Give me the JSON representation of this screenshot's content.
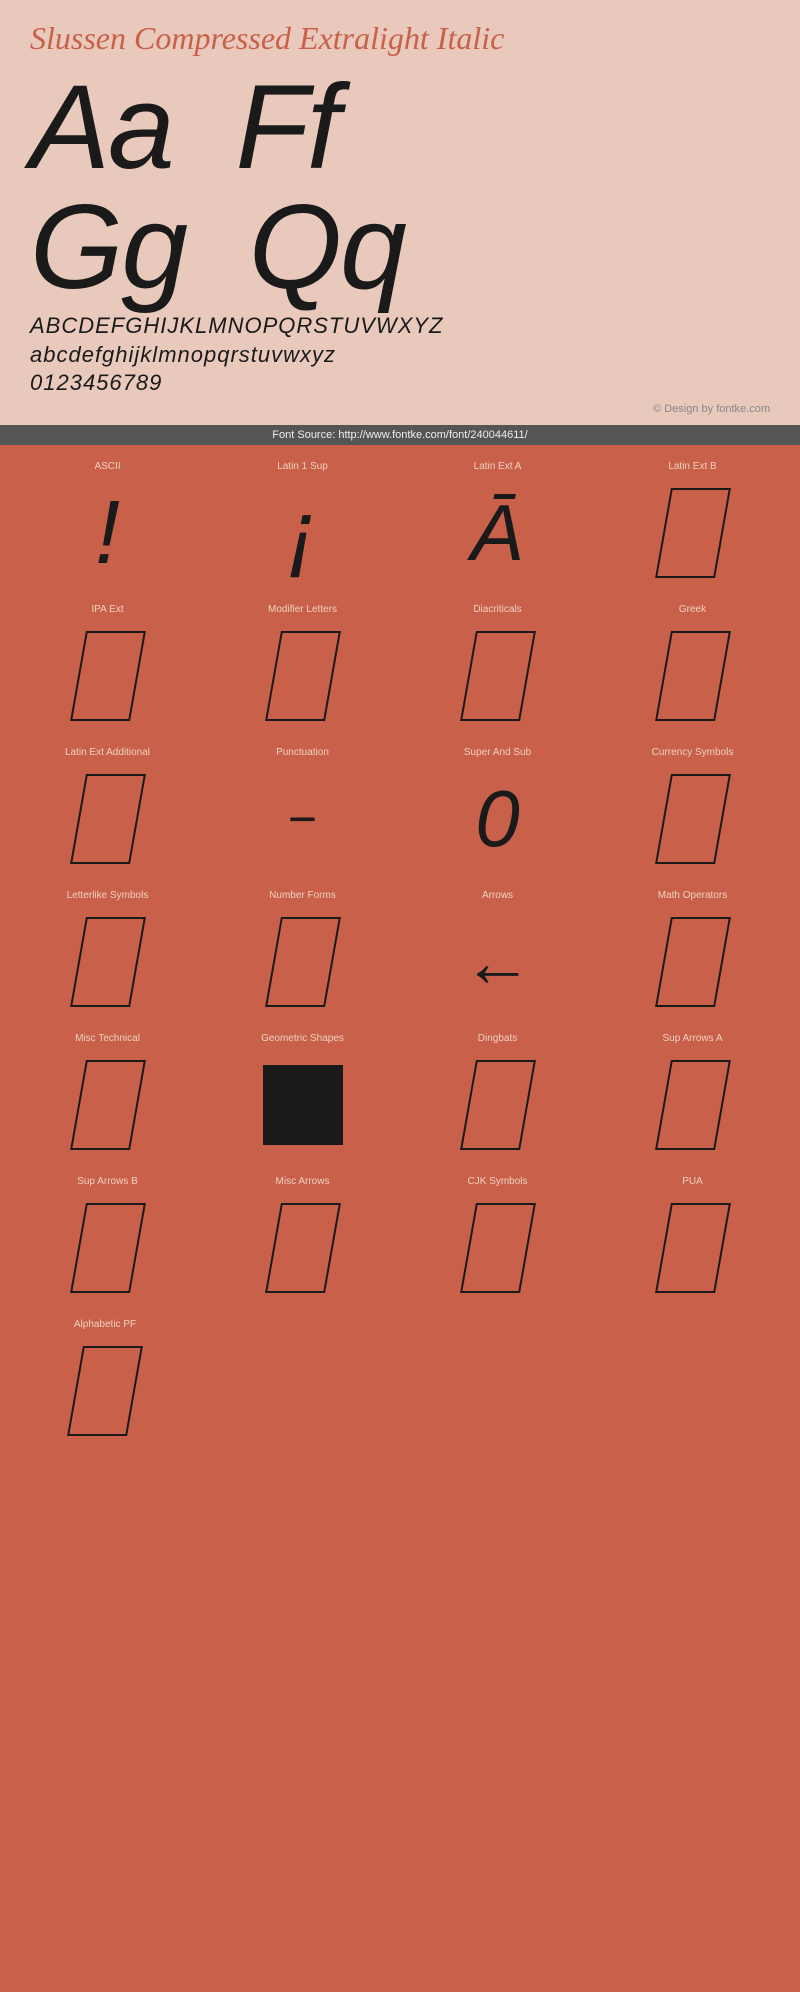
{
  "header": {
    "title": "Slussen Compressed Extralight Italic",
    "glyphs_large": [
      "Aa",
      "Ff"
    ],
    "glyphs_large_single": "a",
    "glyphs_row2": [
      "Gg",
      "Qq"
    ],
    "alphabet_upper": "ABCDEFGHIJKLMNOPQRSTUVWXYZ",
    "alphabet_lower": "abcdefghijklmnopqrstuvwxyz",
    "digits": "0123456789",
    "copyright": "© Design by fontke.com",
    "source": "Font Source: http://www.fontke.com/font/240044611/"
  },
  "grid": {
    "rows": [
      [
        {
          "label": "ASCII",
          "glyph_type": "exclaim"
        },
        {
          "label": "Latin 1 Sup",
          "glyph_type": "inv_exclaim"
        },
        {
          "label": "Latin Ext A",
          "glyph_type": "A_macron"
        },
        {
          "label": "Latin Ext B",
          "glyph_type": "parallelogram"
        }
      ],
      [
        {
          "label": "IPA Ext",
          "glyph_type": "parallelogram"
        },
        {
          "label": "Modifier Letters",
          "glyph_type": "parallelogram"
        },
        {
          "label": "Diacriticals",
          "glyph_type": "parallelogram"
        },
        {
          "label": "Greek",
          "glyph_type": "parallelogram"
        }
      ],
      [
        {
          "label": "Latin Ext Additional",
          "glyph_type": "parallelogram"
        },
        {
          "label": "Punctuation",
          "glyph_type": "dash"
        },
        {
          "label": "Super And Sub",
          "glyph_type": "zero"
        },
        {
          "label": "Currency Symbols",
          "glyph_type": "parallelogram"
        }
      ],
      [
        {
          "label": "Letterlike Symbols",
          "glyph_type": "parallelogram"
        },
        {
          "label": "Number Forms",
          "glyph_type": "parallelogram"
        },
        {
          "label": "Arrows",
          "glyph_type": "arrow"
        },
        {
          "label": "Math Operators",
          "glyph_type": "parallelogram"
        }
      ],
      [
        {
          "label": "Misc Technical",
          "glyph_type": "parallelogram"
        },
        {
          "label": "Geometric Shapes",
          "glyph_type": "square_filled"
        },
        {
          "label": "Dingbats",
          "glyph_type": "parallelogram"
        },
        {
          "label": "Sup Arrows A",
          "glyph_type": "parallelogram"
        }
      ],
      [
        {
          "label": "Sup Arrows B",
          "glyph_type": "parallelogram"
        },
        {
          "label": "Misc Arrows",
          "glyph_type": "parallelogram"
        },
        {
          "label": "CJK Symbols",
          "glyph_type": "parallelogram"
        },
        {
          "label": "PUA",
          "glyph_type": "parallelogram"
        }
      ],
      [
        {
          "label": "Alphabetic PF",
          "glyph_type": "parallelogram"
        },
        {
          "label": "",
          "glyph_type": "empty"
        },
        {
          "label": "",
          "glyph_type": "empty"
        },
        {
          "label": "",
          "glyph_type": "empty"
        }
      ]
    ]
  }
}
